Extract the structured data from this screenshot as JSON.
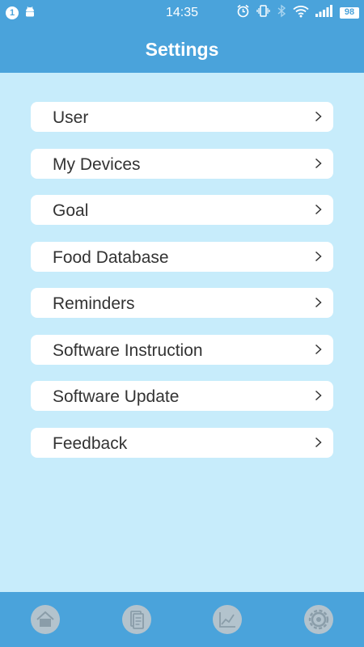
{
  "status_bar": {
    "notification_count": "1",
    "time": "14:35",
    "battery": "98",
    "icons": [
      "android-icon",
      "alarm-icon",
      "vibrate-icon",
      "bluetooth-icon",
      "wifi-icon",
      "signal-icon",
      "battery-icon"
    ]
  },
  "header": {
    "title": "Settings"
  },
  "menu": {
    "items": [
      {
        "label": "User"
      },
      {
        "label": "My Devices"
      },
      {
        "label": "Goal"
      },
      {
        "label": "Food Database"
      },
      {
        "label": "Reminders"
      },
      {
        "label": "Software Instruction"
      },
      {
        "label": "Software Update"
      },
      {
        "label": "Feedback"
      }
    ]
  },
  "bottom_nav": {
    "items": [
      {
        "icon": "home-icon"
      },
      {
        "icon": "records-icon"
      },
      {
        "icon": "chart-icon"
      },
      {
        "icon": "settings-icon",
        "active": true
      }
    ]
  },
  "colors": {
    "bar": "#4aa3db",
    "background": "#c7ecfb",
    "card": "#ffffff",
    "text": "#333333",
    "nav_icon": "#b3c3cd"
  }
}
